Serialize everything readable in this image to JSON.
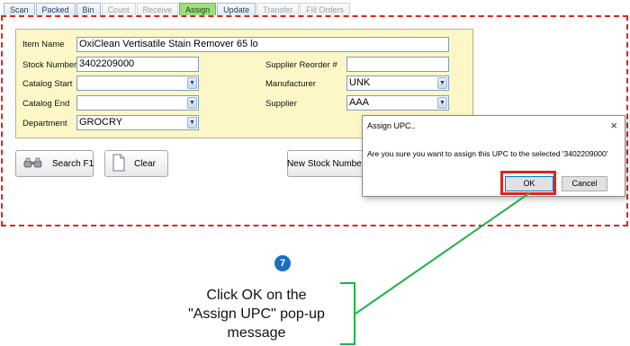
{
  "tabs": [
    {
      "label": "Scan",
      "state": "normal"
    },
    {
      "label": "Packed",
      "state": "normal"
    },
    {
      "label": "Bin",
      "state": "normal"
    },
    {
      "label": "Count",
      "state": "disabled"
    },
    {
      "label": "Receive",
      "state": "disabled"
    },
    {
      "label": "Assign",
      "state": "active"
    },
    {
      "label": "Update",
      "state": "normal"
    },
    {
      "label": "Transfer",
      "state": "disabled"
    },
    {
      "label": "Fill Orders",
      "state": "disabled"
    }
  ],
  "form": {
    "item_name_label": "Item Name",
    "item_name_value": "OxiClean Vertisatile Stain Remover 65 lo",
    "stock_number_label": "Stock Number",
    "stock_number_value": "3402209000",
    "supplier_reorder_label": "Supplier Reorder #",
    "supplier_reorder_value": "",
    "catalog_start_label": "Catalog Start",
    "catalog_start_value": "",
    "manufacturer_label": "Manufacturer",
    "manufacturer_value": "UNK",
    "catalog_end_label": "Catalog End",
    "catalog_end_value": "",
    "supplier_label": "Supplier",
    "supplier_value": "AAA",
    "department_label": "Department",
    "department_value": "GROCRY"
  },
  "buttons": {
    "search": "Search F1",
    "clear": "Clear",
    "new_stock_number": "New Stock Number"
  },
  "dialog": {
    "title": "Assign UPC..",
    "close": "×",
    "message": "Are you sure you want to assign this UPC to the selected '3402209000'",
    "ok": "OK",
    "cancel": "Cancel"
  },
  "annotation": {
    "step_number": "7",
    "instruction_line1": "Click OK on the",
    "instruction_line2": "\"Assign UPC\" pop-up",
    "instruction_line3": "message"
  },
  "colors": {
    "highlight_red": "#e2231a",
    "callout_green": "#22b14c",
    "step_blue": "#1a6fc3",
    "form_yellow": "#fdf7c7",
    "active_tab_green": "#9be07a"
  }
}
